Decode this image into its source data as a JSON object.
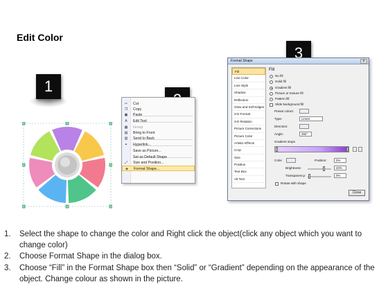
{
  "title": "Edit Color",
  "badges": [
    "1",
    "2",
    "3"
  ],
  "donut_colors": [
    "#b982e6",
    "#f8c84b",
    "#f27a8e",
    "#4fc58a",
    "#5bb4f2",
    "#ee8cbc",
    "#b2e35b",
    "#d1d1d1"
  ],
  "context_menu": {
    "items": [
      {
        "label": "Cut",
        "icon": "cut-icon",
        "glyph": "✂",
        "disabled": false
      },
      {
        "label": "Copy",
        "icon": "copy-icon",
        "glyph": "❐",
        "disabled": false
      },
      {
        "label": "Paste",
        "icon": "paste-icon",
        "glyph": "▣",
        "disabled": false
      },
      {
        "label": "Edit Text",
        "icon": "edit-text-icon",
        "glyph": "A",
        "disabled": false
      },
      {
        "label": "Group",
        "icon": "group-icon",
        "glyph": "▦",
        "disabled": true
      },
      {
        "label": "Bring to Front",
        "icon": "bring-front-icon",
        "glyph": "▤",
        "disabled": false
      },
      {
        "label": "Send to Back",
        "icon": "send-back-icon",
        "glyph": "▥",
        "disabled": false
      },
      {
        "label": "Hyperlink...",
        "icon": "hyperlink-icon",
        "glyph": "⚭",
        "disabled": false
      },
      {
        "label": "Save as Picture...",
        "icon": "",
        "glyph": "",
        "disabled": false
      },
      {
        "label": "Set as Default Shape",
        "icon": "",
        "glyph": "",
        "disabled": false
      },
      {
        "label": "Size and Position...",
        "icon": "size-icon",
        "glyph": "⤢",
        "disabled": false
      },
      {
        "label": "Format Shape...",
        "icon": "format-shape-icon",
        "glyph": "◈",
        "disabled": false,
        "highlight": true
      }
    ]
  },
  "dialog": {
    "title": "Format Shape",
    "close_x": "x",
    "categories": [
      "Fill",
      "Line Color",
      "Line Style",
      "Shadow",
      "Reflection",
      "Glow and Soft Edges",
      "3-D Format",
      "3-D Rotation",
      "Picture Corrections",
      "Picture Color",
      "Artistic Effects",
      "Crop",
      "Size",
      "Position",
      "Text Box",
      "Alt Text"
    ],
    "selected_category": "Fill",
    "fill_heading": "Fill",
    "fill_options": [
      {
        "label": "No fill",
        "checked": false
      },
      {
        "label": "Solid fill",
        "checked": false
      },
      {
        "label": "Gradient fill",
        "checked": true
      },
      {
        "label": "Picture or texture fill",
        "checked": false
      },
      {
        "label": "Pattern fill",
        "checked": false
      }
    ],
    "slide_background_label": "Slide background fill",
    "preset_colors_label": "Preset colors:",
    "type_label": "Type:",
    "type_value": "Linear",
    "direction_label": "Direction:",
    "angle_label": "Angle:",
    "angle_value": "350°",
    "gradient_stops_label": "Gradient stops",
    "color_label": "Color",
    "position_label": "Position:",
    "position_value": "0%",
    "brightness_label": "Brightness:",
    "brightness_value": "40%",
    "transparency_label": "Transparency:",
    "transparency_value": "0%",
    "rotate_label": "Rotate with shape",
    "close_button": "Close"
  },
  "instructions": [
    {
      "num": "1.",
      "text": "Select the shape to change the color and Right click the object(click any object which you want to change color)"
    },
    {
      "num": "2.",
      "text": "Choose Format Shape in the dialog box."
    },
    {
      "num": "3.",
      "text": "Choose “Fill” in the Format Shape box then “Solid” or “Gradient” depending on the appearance of the object. Change colour as shown in the picture."
    }
  ]
}
